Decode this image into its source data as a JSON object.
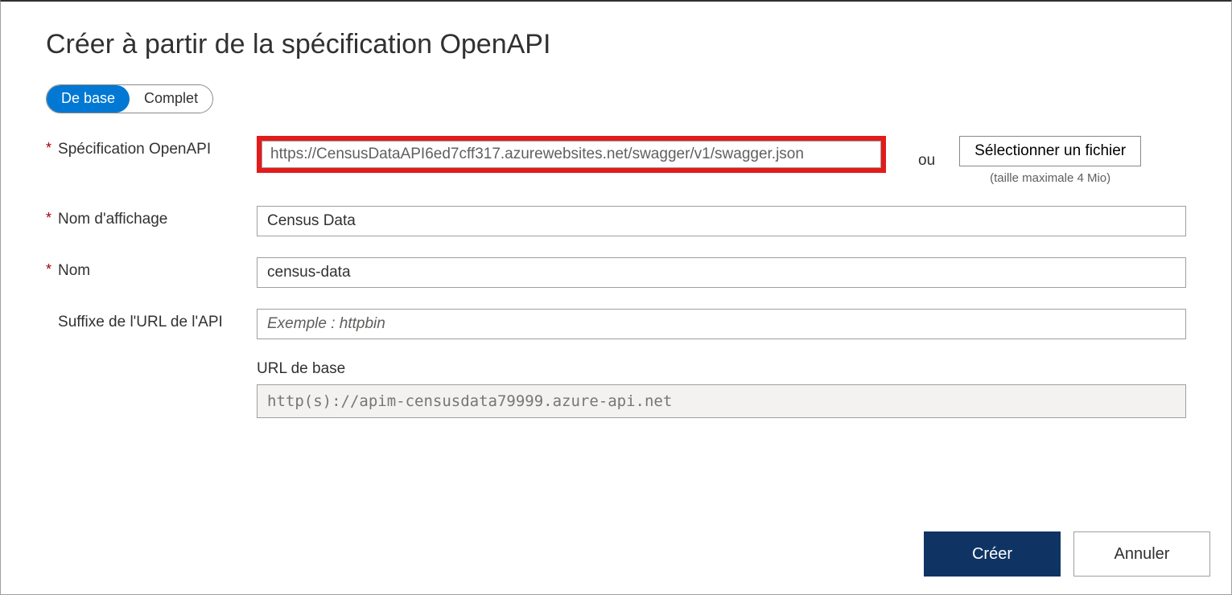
{
  "title": "Créer à partir de la spécification OpenAPI",
  "toggle": {
    "basic": "De base",
    "full": "Complet"
  },
  "labels": {
    "spec": "Spécification OpenAPI",
    "display_name": "Nom d'affichage",
    "name": "Nom",
    "suffix": "Suffixe de l'URL de l'API",
    "base_url": "URL de base",
    "or": "ou"
  },
  "values": {
    "spec": "https://CensusDataAPI6ed7cff317.azurewebsites.net/swagger/v1/swagger.json",
    "display_name": "Census Data",
    "name": "census-data",
    "suffix": "",
    "base_url": "http(s)://apim-censusdata79999.azure-api.net"
  },
  "placeholders": {
    "suffix": "Exemple : httpbin"
  },
  "file": {
    "button": "Sélectionner un fichier",
    "hint": "(taille maximale 4 Mio)"
  },
  "buttons": {
    "create": "Créer",
    "cancel": "Annuler"
  }
}
